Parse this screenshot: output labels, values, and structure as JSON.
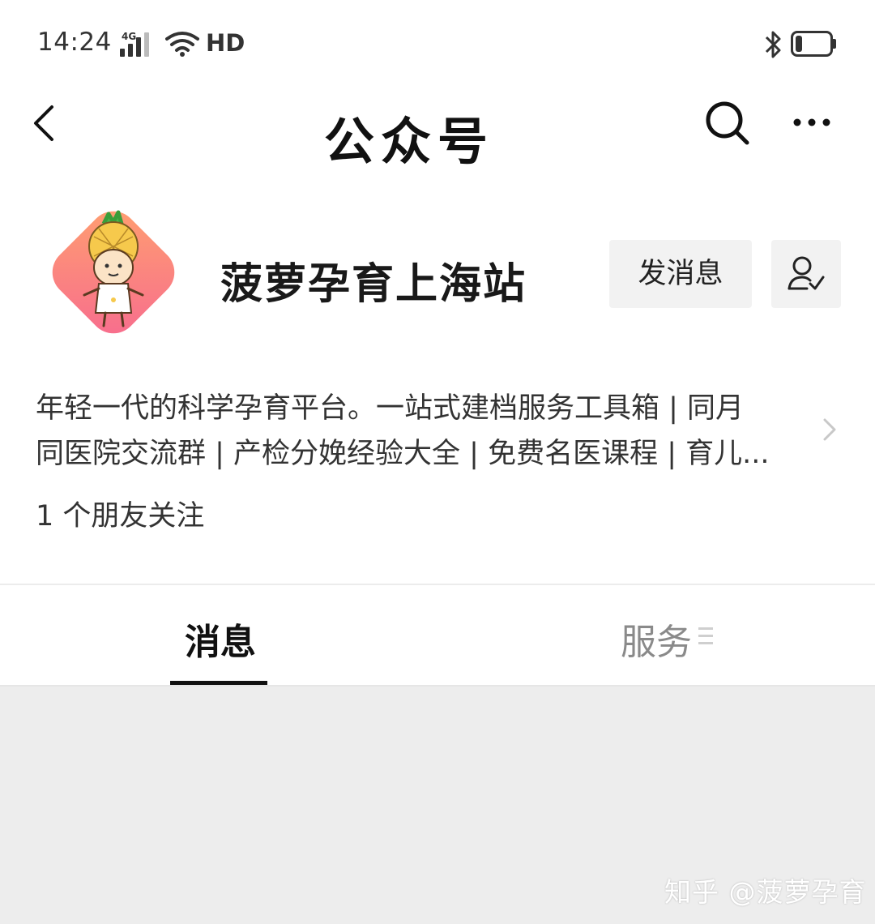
{
  "status_bar": {
    "time": "14:24",
    "network": "4G",
    "hd_label": "HD",
    "battery_level": 0.2
  },
  "nav": {
    "title": "公众号",
    "icons": [
      "back-arrow-icon",
      "search-icon",
      "more-icon"
    ]
  },
  "profile": {
    "name": "菠萝孕育上海站",
    "message_button_label": "发消息",
    "followed_icon": "followed-user-icon",
    "avatar_colors": [
      "#ff9a76",
      "#fa6f8a"
    ],
    "description_lines": [
      "年轻一代的科学孕育平台。一站式建档服务工具箱 | 同月",
      "同医院交流群 | 产检分娩经验大全 | 免费名医课程 | 育儿..."
    ],
    "friends_follow": "1 个朋友关注"
  },
  "tabs": [
    {
      "label": "消息",
      "active": true
    },
    {
      "label": "服务",
      "active": false
    }
  ],
  "watermark": "知乎 @菠萝孕育"
}
